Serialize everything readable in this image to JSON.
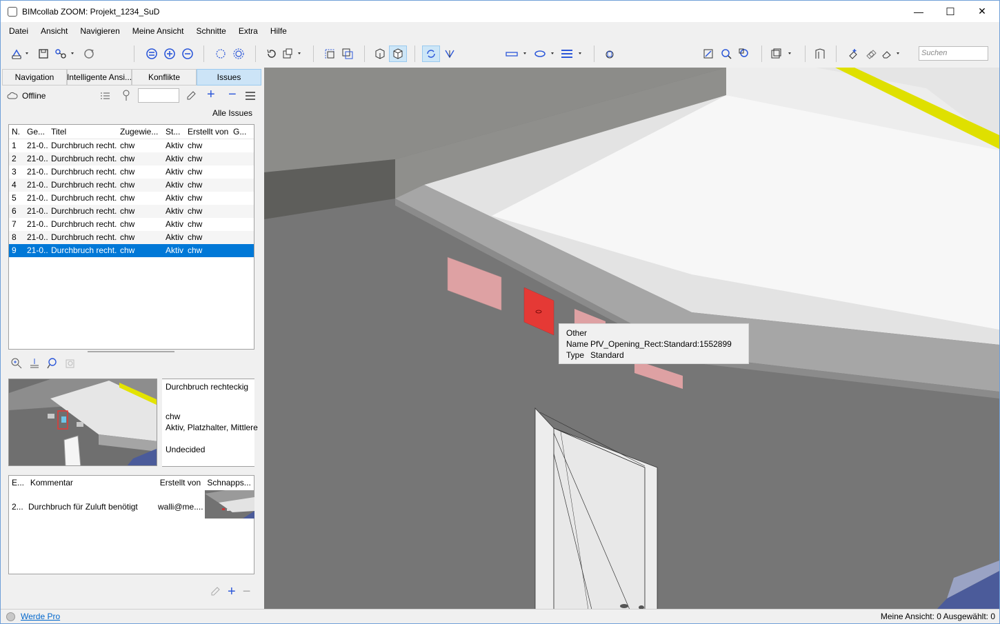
{
  "window": {
    "title": "BIMcollab ZOOM: Projekt_1234_SuD",
    "minimize": "—",
    "maximize": "☐",
    "close": "✕"
  },
  "menu": [
    "Datei",
    "Ansicht",
    "Navigieren",
    "Meine Ansicht",
    "Schnitte",
    "Extra",
    "Hilfe"
  ],
  "toolbar": {
    "search_placeholder": "Suchen"
  },
  "tabs": [
    "Navigation",
    "Intelligente Ansi...",
    "Konflikte",
    "Issues"
  ],
  "active_tab": "Issues",
  "issues_bar": {
    "status": "Offline",
    "filter_label": "Alle Issues"
  },
  "issues_table": {
    "headers": [
      "N.",
      "Ge...",
      "Titel",
      "Zugewie...",
      "St...",
      "Erstellt von",
      "G..."
    ],
    "rows": [
      [
        "1",
        "21-0...",
        "Durchbruch recht...",
        "chw",
        "Aktiv",
        "chw",
        ""
      ],
      [
        "2",
        "21-0...",
        "Durchbruch recht...",
        "chw",
        "Aktiv",
        "chw",
        ""
      ],
      [
        "3",
        "21-0...",
        "Durchbruch recht...",
        "chw",
        "Aktiv",
        "chw",
        ""
      ],
      [
        "4",
        "21-0...",
        "Durchbruch recht...",
        "chw",
        "Aktiv",
        "chw",
        ""
      ],
      [
        "5",
        "21-0...",
        "Durchbruch recht...",
        "chw",
        "Aktiv",
        "chw",
        ""
      ],
      [
        "6",
        "21-0...",
        "Durchbruch recht...",
        "chw",
        "Aktiv",
        "chw",
        ""
      ],
      [
        "7",
        "21-0...",
        "Durchbruch recht...",
        "chw",
        "Aktiv",
        "chw",
        ""
      ],
      [
        "8",
        "21-0...",
        "Durchbruch recht...",
        "chw",
        "Aktiv",
        "chw",
        ""
      ],
      [
        "9",
        "21-0...",
        "Durchbruch recht...",
        "chw",
        "Aktiv",
        "chw",
        ""
      ]
    ],
    "selected_row": 9
  },
  "issue_detail": {
    "title": "Durchbruch rechteckig",
    "assigned": "chw",
    "status_line": "Aktiv, Platzhalter, Mittlere",
    "decision": "Undecided"
  },
  "comments_table": {
    "headers": [
      "E...",
      "Kommentar",
      "Erstellt von",
      "Schnapps..."
    ],
    "rows": [
      {
        "e": "2...",
        "comment": "Durchbruch für Zuluft benötigt",
        "author": "walli@me...."
      }
    ]
  },
  "tooltip": {
    "category": "Other",
    "name_label": "Name",
    "name_value": "PfV_Opening_Rect:Standard:1552899",
    "type_label": "Type",
    "type_value": "Standard"
  },
  "status": {
    "pro_link": "Werde Pro",
    "right": "Meine Ansicht: 0  Ausgewählt: 0"
  },
  "colors": {
    "selection": "#0078d7",
    "accent": "#2b57d9",
    "highlight_opening": "#e53935",
    "opening": "#dea1a3",
    "yellow_rail": "#dfe000"
  }
}
